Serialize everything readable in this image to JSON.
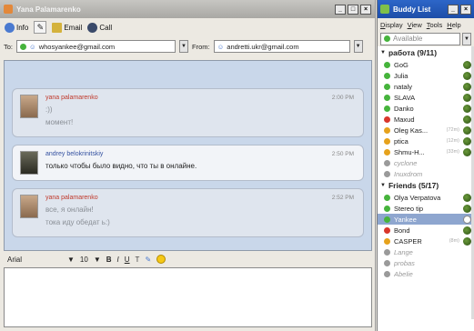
{
  "chat_window": {
    "title": "Yana Palamarenko",
    "toolbar": {
      "info": "Info",
      "email": "Email",
      "call": "Call"
    },
    "to_label": "To:",
    "to_value": "whosyankee@gmail.com",
    "from_label": "From:",
    "from_value": "andretti.ukr@gmail.com",
    "messages": [
      {
        "sender": "yana palamarenko",
        "time": "2:00 PM",
        "lines": [
          ":))",
          "момент!"
        ],
        "style": "red"
      },
      {
        "sender": "andrey belokrinitskiy",
        "time": "2:50 PM",
        "lines": [
          "только чтобы было видно, что ты в онлайне."
        ],
        "style": "blue"
      },
      {
        "sender": "yana palamarenko",
        "time": "2:52 PM",
        "lines": [
          "все, я онлайн!",
          "тока иду обедат ь:)"
        ],
        "style": "red"
      }
    ],
    "format_bar": {
      "font": "Arial",
      "size": "10",
      "bold": "B",
      "italic": "I",
      "underline": "U"
    }
  },
  "buddy_list": {
    "title": "Buddy List",
    "menu": [
      "Display",
      "View",
      "Tools",
      "Help"
    ],
    "status": "Available",
    "groups": [
      {
        "name": "работа (9/11)",
        "buddies": [
          {
            "name": "GoG",
            "status": "online"
          },
          {
            "name": "Julia",
            "status": "online"
          },
          {
            "name": "nataly",
            "status": "online"
          },
          {
            "name": "SLAVA",
            "status": "online"
          },
          {
            "name": "Danko",
            "status": "online"
          },
          {
            "name": "Maxud",
            "status": "busy"
          },
          {
            "name": "Oleg Kas...",
            "status": "idle",
            "idle": "(72m)"
          },
          {
            "name": "ptica",
            "status": "idle",
            "idle": "(12m)"
          },
          {
            "name": "Shmu-H...",
            "status": "idle",
            "idle": "(33m)"
          },
          {
            "name": "cyclone",
            "status": "offline"
          },
          {
            "name": "Inuxdrom",
            "status": "offline"
          }
        ]
      },
      {
        "name": "Friends (5/17)",
        "buddies": [
          {
            "name": "Olya Verpatova",
            "status": "online"
          },
          {
            "name": "Stereo tip",
            "status": "online"
          },
          {
            "name": "Yankee",
            "status": "online",
            "selected": true
          },
          {
            "name": "Bond",
            "status": "busy"
          },
          {
            "name": "CASPER",
            "status": "idle",
            "idle": "(8m)"
          },
          {
            "name": "Lange",
            "status": "offline"
          },
          {
            "name": "probas",
            "status": "offline"
          },
          {
            "name": "Abelie",
            "status": "offline"
          }
        ]
      }
    ]
  },
  "colors": {
    "online": "#46b43c",
    "busy": "#d9362b",
    "idle": "#e6a21c",
    "offline": "#9a9a9a",
    "chat_bg": "#c9d7ea",
    "buddy_title": "#2d66c8"
  }
}
